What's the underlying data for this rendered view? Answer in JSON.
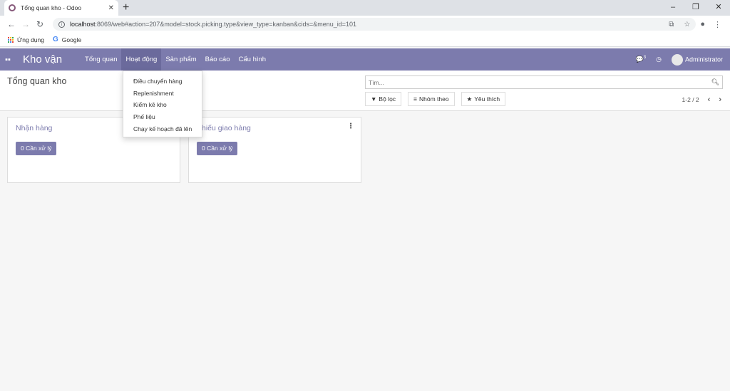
{
  "browser": {
    "tab_title": "Tổng quan kho - Odoo",
    "tab_close": "✕",
    "new_tab": "+",
    "window_controls": [
      "–",
      "❐",
      "✕"
    ],
    "url_host": "localhost",
    "url_path": ":8069/web#action=207&model=stock.picking.type&view_type=kanban&cids=&menu_id=101",
    "bookmarks": [
      "Ứng dụng",
      "Google"
    ]
  },
  "odoo": {
    "apps_icon": "apps-grid-icon",
    "brand": "Kho vận",
    "menu": [
      "Tổng quan",
      "Hoạt động",
      "Sản phẩm",
      "Báo cáo",
      "Cấu hình"
    ],
    "active_menu_index": 1,
    "chat_count": "3",
    "user": "Administrator"
  },
  "control_panel": {
    "breadcrumb": "Tổng quan kho",
    "search_placeholder": "Tìm...",
    "filters": [
      "Bộ lọc",
      "Nhóm theo",
      "Yêu thích"
    ],
    "pager": "1-2 / 2"
  },
  "dropdown": {
    "items": [
      "Điều chuyển hàng",
      "Replenishment",
      "Kiểm kê kho",
      "Phế liệu",
      "Chạy kế hoạch đã lên"
    ]
  },
  "kanban": {
    "cards": [
      {
        "name": "Nhận hàng",
        "action": "0 Cần xử lý"
      },
      {
        "name": "Phiếu giao hàng",
        "action": "0 Cần xử lý"
      }
    ]
  },
  "colors": {
    "primary": "#7c7bad",
    "nav_active": "#6b6a9c",
    "background": "#f6f6f6"
  }
}
